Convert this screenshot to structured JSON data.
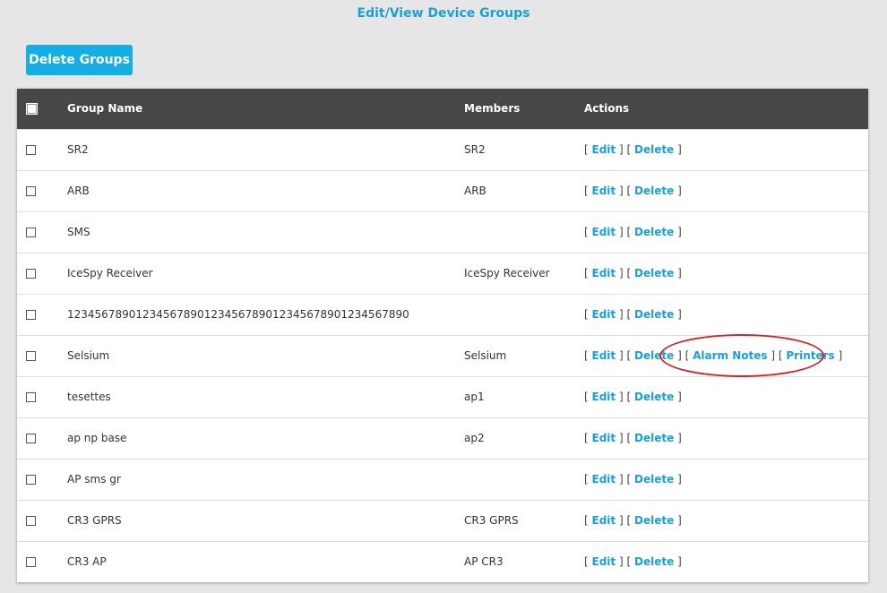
{
  "title": "Edit/View Device Groups",
  "delete_groups_label": "Delete Groups",
  "columns": {
    "group_name": "Group Name",
    "members": "Members",
    "actions": "Actions"
  },
  "action_labels": {
    "edit": "Edit",
    "delete": "Delete",
    "alarm_notes": "Alarm Notes",
    "printers": "Printers",
    "open": "[",
    "close": "]"
  },
  "rows": [
    {
      "name": "SR2",
      "members": "SR2",
      "extra": false
    },
    {
      "name": "ARB",
      "members": "ARB",
      "extra": false
    },
    {
      "name": "SMS",
      "members": "",
      "extra": false
    },
    {
      "name": "IceSpy Receiver",
      "members": "IceSpy Receiver",
      "extra": false
    },
    {
      "name": "1234567890123456789012345678901234567890123456789 0",
      "members": "",
      "extra": false
    },
    {
      "name": "Selsium",
      "members": "Selsium",
      "extra": true
    },
    {
      "name": "tesettes",
      "members": "ap1",
      "extra": false
    },
    {
      "name": "ap np base",
      "members": "ap2",
      "extra": false
    },
    {
      "name": "AP sms gr",
      "members": "",
      "extra": false
    },
    {
      "name": "CR3 GPRS",
      "members": "CR3 GPRS",
      "extra": false
    },
    {
      "name": "CR3 AP",
      "members": "AP CR3",
      "extra": false
    }
  ],
  "colors": {
    "accent": "#1aa0d8",
    "button_bg": "#14aee4",
    "header_bg": "#474747",
    "annotation": "#d2232a"
  }
}
